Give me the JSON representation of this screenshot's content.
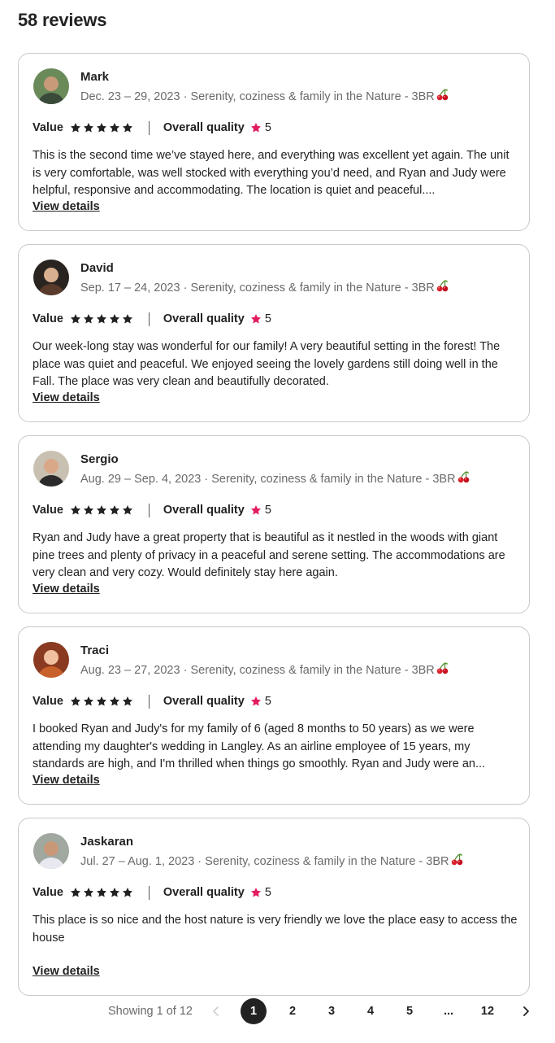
{
  "header": {
    "title": "58 reviews"
  },
  "reviews": [
    {
      "name": "Mark",
      "dates": "Dec. 23 – 29, 2023",
      "listing": "Serenity, coziness & family in the Nature - 3BR",
      "value_label": "Value",
      "quality_label": "Overall quality",
      "value_stars": 5,
      "quality_score": "5",
      "text": "This is the second time we’ve stayed here, and everything was excellent yet again. The unit is very comfortable, was well stocked with everything you’d need, and Ryan and Judy were helpful, responsive and accommodating. The location is quiet and peaceful....",
      "details_label": "View details",
      "avatar_colors": [
        "#6a8a5a",
        "#3a4a3a",
        "#c89a7a"
      ]
    },
    {
      "name": "David",
      "dates": "Sep. 17 – 24, 2023",
      "listing": "Serenity, coziness & family in the Nature - 3BR",
      "value_label": "Value",
      "quality_label": "Overall quality",
      "value_stars": 5,
      "quality_score": "5",
      "text": "Our week-long stay was wonderful for our family! A very beautiful setting in the forest! The place was quiet and peaceful. We enjoyed seeing the lovely gardens still doing well in the Fall. The place was very clean and beautifully decorated.",
      "details_label": "View details",
      "avatar_colors": [
        "#2a2420",
        "#5a3a2a",
        "#d8b090"
      ]
    },
    {
      "name": "Sergio",
      "dates": "Aug. 29 – Sep. 4, 2023",
      "listing": "Serenity, coziness & family in the Nature - 3BR",
      "value_label": "Value",
      "quality_label": "Overall quality",
      "value_stars": 5,
      "quality_score": "5",
      "text": "Ryan and Judy have a great property that is beautiful as it nestled in the woods with giant pine trees and plenty of privacy in a peaceful and serene setting. The accommodations are very clean and very cozy. Would definitely stay here again.",
      "details_label": "View details",
      "avatar_colors": [
        "#c8c0b0",
        "#2a2a2a",
        "#d8a888"
      ]
    },
    {
      "name": "Traci",
      "dates": "Aug. 23 – 27, 2023",
      "listing": "Serenity, coziness & family in the Nature - 3BR",
      "value_label": "Value",
      "quality_label": "Overall quality",
      "value_stars": 5,
      "quality_score": "5",
      "text": "I booked Ryan and Judy's for my family of 6 (aged 8 months to 50 years) as we were attending my daughter's wedding in Langley. As an airline employee of 15 years, my standards are high, and I'm thrilled when things go smoothly. Ryan and Judy were an...",
      "details_label": "View details",
      "avatar_colors": [
        "#8a3a20",
        "#c8602a",
        "#f0c0a0"
      ]
    },
    {
      "name": "Jaskaran",
      "dates": "Jul. 27 – Aug. 1, 2023",
      "listing": "Serenity, coziness & family in the Nature - 3BR",
      "value_label": "Value",
      "quality_label": "Overall quality",
      "value_stars": 5,
      "quality_score": "5",
      "text": "This place is so nice and the host nature is very friendly we love the place easy to access the house",
      "details_label": "View details",
      "avatar_colors": [
        "#a0a8a0",
        "#e8e8f0",
        "#c89878"
      ]
    }
  ],
  "pagination": {
    "showing": "Showing 1 of 12",
    "pages": [
      "1",
      "2",
      "3",
      "4",
      "5",
      "...",
      "12"
    ],
    "current": "1"
  },
  "colors": {
    "accent_star": "#e31c5f",
    "text": "#222222",
    "muted": "#6a6a6a",
    "border": "#c9c9c9"
  },
  "icons": [
    "star-icon",
    "cherry-icon",
    "chevron-left-icon",
    "chevron-right-icon"
  ]
}
